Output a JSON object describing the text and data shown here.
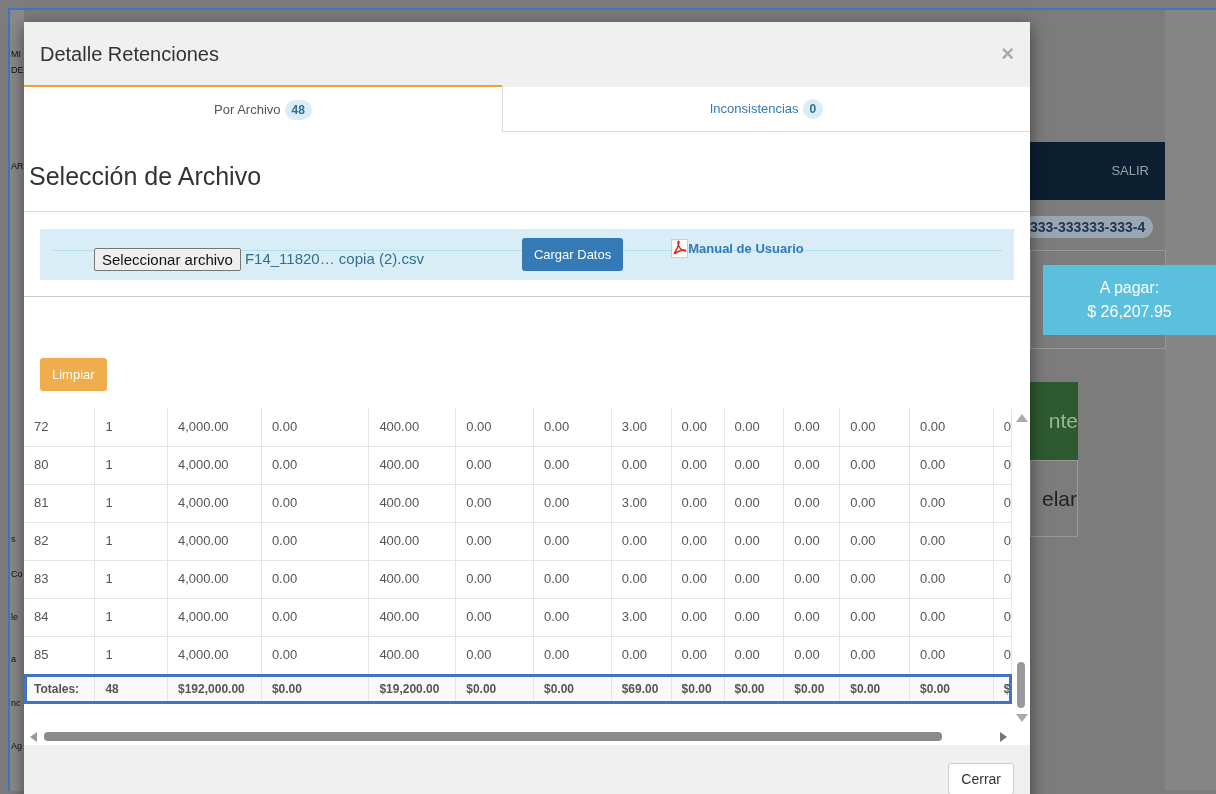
{
  "background": {
    "left_fragments": [
      "MI",
      "DE",
      "AR",
      "s",
      "Co",
      "le",
      "a",
      "nc",
      "Ag"
    ],
    "nav_link": "SALIR",
    "id_badge": "333-333333-333-4",
    "payment": {
      "label": "A pagar:",
      "amount": "$ 26,207.95"
    },
    "green_button": "nte",
    "cancel_button": "elar"
  },
  "modal": {
    "title": "Detalle Retenciones",
    "close": "×",
    "tabs": [
      {
        "label": "Por Archivo",
        "count": "48",
        "selected": true
      },
      {
        "label": "Inconsistencias",
        "count": "0",
        "selected": false
      }
    ],
    "section_title": "Selección de Archivo",
    "file_picker": {
      "button": "Seleccionar archivo",
      "file_name": "F14_11820… copia (2).csv"
    },
    "load_button": "Cargar Datos",
    "manual_link": "Manual de Usuario",
    "clear_button": "Limpiar",
    "table": {
      "rows": [
        [
          "72",
          "1",
          "4,000.00",
          "0.00",
          "400.00",
          "0.00",
          "0.00",
          "3.00",
          "0.00",
          "0.00",
          "0.00",
          "0.00",
          "0.00",
          "0"
        ],
        [
          "80",
          "1",
          "4,000.00",
          "0.00",
          "400.00",
          "0.00",
          "0.00",
          "0.00",
          "0.00",
          "0.00",
          "0.00",
          "0.00",
          "0.00",
          "0"
        ],
        [
          "81",
          "1",
          "4,000.00",
          "0.00",
          "400.00",
          "0.00",
          "0.00",
          "3.00",
          "0.00",
          "0.00",
          "0.00",
          "0.00",
          "0.00",
          "0"
        ],
        [
          "82",
          "1",
          "4,000.00",
          "0.00",
          "400.00",
          "0.00",
          "0.00",
          "0.00",
          "0.00",
          "0.00",
          "0.00",
          "0.00",
          "0.00",
          "0"
        ],
        [
          "83",
          "1",
          "4,000.00",
          "0.00",
          "400.00",
          "0.00",
          "0.00",
          "0.00",
          "0.00",
          "0.00",
          "0.00",
          "0.00",
          "0.00",
          "0"
        ],
        [
          "84",
          "1",
          "4,000.00",
          "0.00",
          "400.00",
          "0.00",
          "0.00",
          "3.00",
          "0.00",
          "0.00",
          "0.00",
          "0.00",
          "0.00",
          "0"
        ],
        [
          "85",
          "1",
          "4,000.00",
          "0.00",
          "400.00",
          "0.00",
          "0.00",
          "0.00",
          "0.00",
          "0.00",
          "0.00",
          "0.00",
          "0.00",
          "0"
        ]
      ],
      "totals": [
        "Totales:",
        "48",
        "$192,000.00",
        "$0.00",
        "$19,200.00",
        "$0.00",
        "$0.00",
        "$69.00",
        "$0.00",
        "$0.00",
        "$0.00",
        "$0.00",
        "$0.00",
        "$"
      ]
    },
    "close_button": "Cerrar"
  }
}
